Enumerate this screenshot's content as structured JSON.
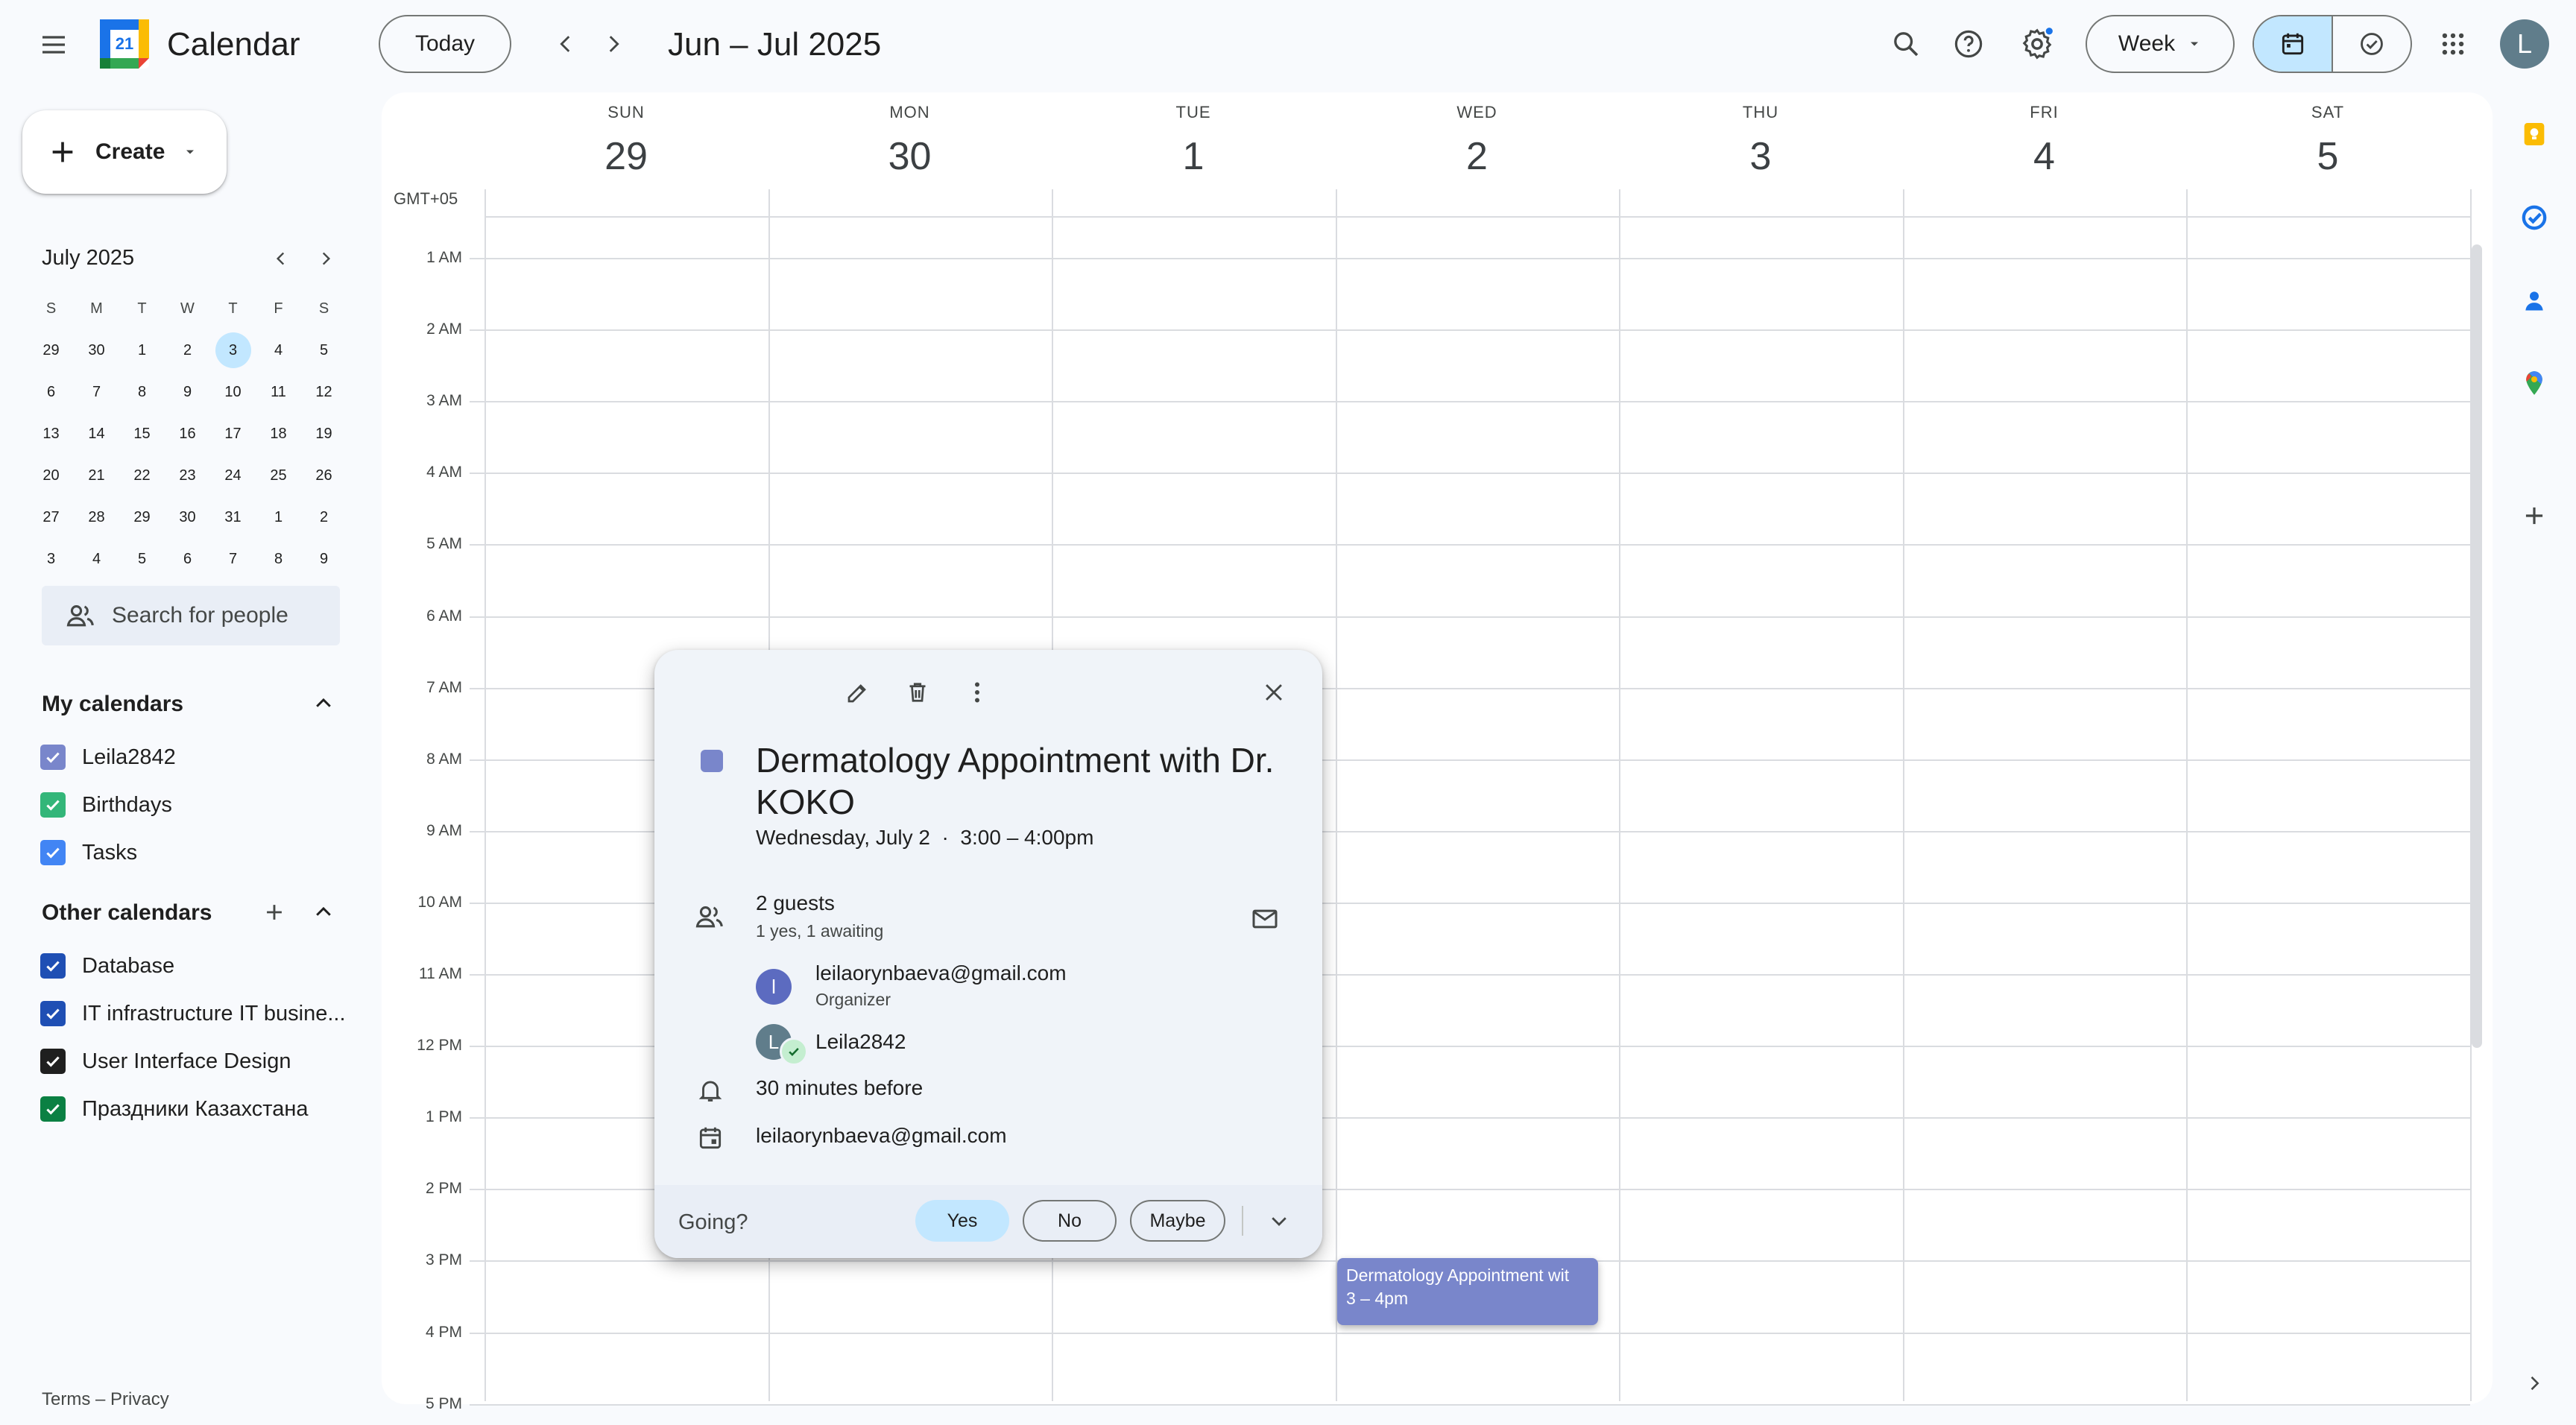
{
  "header": {
    "app_title": "Calendar",
    "logo_day": "21",
    "today_label": "Today",
    "date_range": "Jun – Jul 2025",
    "view_label": "Week",
    "avatar_initial": "L",
    "icons": [
      "main-menu-icon",
      "search-icon",
      "help-icon",
      "settings-icon",
      "apps-grid-icon",
      "calendar-view-icon",
      "tasks-view-icon"
    ]
  },
  "sidebar": {
    "create_label": "Create",
    "mini_calendar": {
      "title": "July 2025",
      "weekdays": [
        "S",
        "M",
        "T",
        "W",
        "T",
        "F",
        "S"
      ],
      "weeks": [
        [
          "29",
          "30",
          "1",
          "2",
          "3",
          "4",
          "5"
        ],
        [
          "6",
          "7",
          "8",
          "9",
          "10",
          "11",
          "12"
        ],
        [
          "13",
          "14",
          "15",
          "16",
          "17",
          "18",
          "19"
        ],
        [
          "20",
          "21",
          "22",
          "23",
          "24",
          "25",
          "26"
        ],
        [
          "27",
          "28",
          "29",
          "30",
          "31",
          "1",
          "2"
        ],
        [
          "3",
          "4",
          "5",
          "6",
          "7",
          "8",
          "9"
        ]
      ],
      "today": "3"
    },
    "people_search_placeholder": "Search for people",
    "my_calendars_title": "My calendars",
    "my_calendars": [
      {
        "label": "Leila2842",
        "color": "#7986cb"
      },
      {
        "label": "Birthdays",
        "color": "#33b679"
      },
      {
        "label": "Tasks",
        "color": "#4285f4"
      }
    ],
    "other_calendars_title": "Other calendars",
    "other_calendars": [
      {
        "label": "Database",
        "color": "#1f4fb4"
      },
      {
        "label": "IT infrastructure IT busine...",
        "color": "#1f4fb4"
      },
      {
        "label": "User Interface Design",
        "color": "#1f1f1f"
      },
      {
        "label": "Праздники Казахстана",
        "color": "#0b8043"
      }
    ],
    "footer": "Terms – Privacy"
  },
  "week": {
    "timezone": "GMT+05",
    "days": [
      {
        "name": "SUN",
        "date": "29"
      },
      {
        "name": "MON",
        "date": "30"
      },
      {
        "name": "TUE",
        "date": "1"
      },
      {
        "name": "WED",
        "date": "2"
      },
      {
        "name": "THU",
        "date": "3"
      },
      {
        "name": "FRI",
        "date": "4"
      },
      {
        "name": "SAT",
        "date": "5"
      }
    ],
    "hours": [
      "1 AM",
      "2 AM",
      "3 AM",
      "4 AM",
      "5 AM",
      "6 AM",
      "7 AM",
      "8 AM",
      "9 AM",
      "10 AM",
      "11 AM",
      "12 PM",
      "1 PM",
      "2 PM",
      "3 PM",
      "4 PM",
      "5 PM"
    ]
  },
  "event_block": {
    "title": "Dermatology Appointment wit",
    "time": "3 – 4pm",
    "color": "#7986cb"
  },
  "popup": {
    "title": "Dermatology Appointment with Dr. KOKO",
    "when": "Wednesday, July 2  ·  3:00 – 4:00pm",
    "guests_title": "2 guests",
    "guests_summary": "1 yes, 1 awaiting",
    "guests": [
      {
        "initial": "l",
        "name": "leilaorynbaeva@gmail.com",
        "role": "Organizer"
      },
      {
        "initial": "L",
        "name": "Leila2842",
        "role": ""
      }
    ],
    "reminder": "30 minutes before",
    "calendar_owner": "leilaorynbaeva@gmail.com",
    "going_label": "Going?",
    "rsvp": {
      "yes": "Yes",
      "no": "No",
      "maybe": "Maybe"
    }
  }
}
